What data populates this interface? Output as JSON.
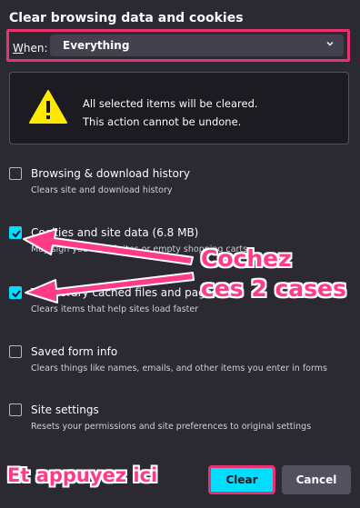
{
  "dialog": {
    "title": "Clear browsing data and cookies",
    "when_label_prefix": "W",
    "when_label_rest": "hen:",
    "when_value": "Everything",
    "warning_line1": "All selected items will be cleared.",
    "warning_line2": "This action cannot be undone."
  },
  "items": [
    {
      "label": "Browsing & download history",
      "desc": "Clears site and download history",
      "checked": false
    },
    {
      "label": "Cookies and site data (6.8 MB)",
      "desc": "May sign you out of sites or empty shopping carts",
      "checked": true
    },
    {
      "label": "Temporary cached files and pages (3",
      "desc": "Clears items that help sites load faster",
      "checked": true
    },
    {
      "label": "Saved form info",
      "desc": "Clears things like names, emails, and other items you enter in forms",
      "checked": false
    },
    {
      "label": "Site settings",
      "desc": "Resets your permissions and site preferences to original settings",
      "checked": false
    }
  ],
  "buttons": {
    "clear": "Clear",
    "cancel": "Cancel"
  },
  "annotations": {
    "line1": "Cochez",
    "line2": "ces 2 cases",
    "line3": "Et appuyez ici"
  },
  "colors": {
    "accent": "#00ddff",
    "annotation": "#e8336f",
    "background": "#2b2a33"
  }
}
